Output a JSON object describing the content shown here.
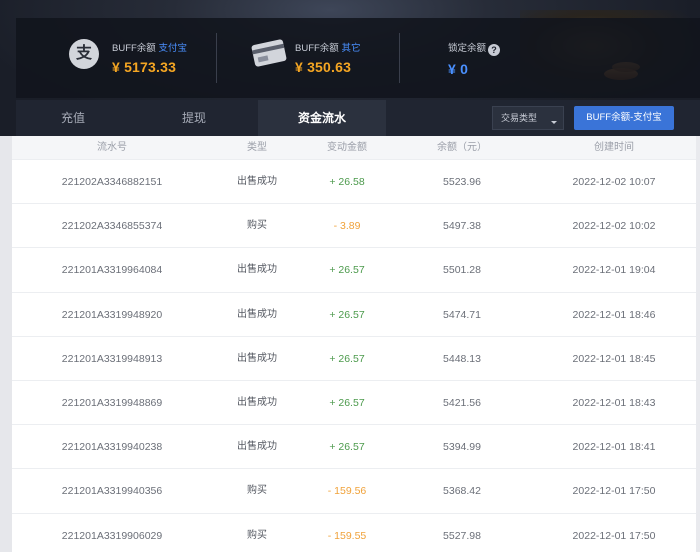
{
  "balances": [
    {
      "label": "BUFF余额",
      "label_link": "支付宝",
      "amount": "¥ 5173.33",
      "icon": "alipay-icon",
      "icon_glyph": "支"
    },
    {
      "label": "BUFF余额",
      "label_link": "其它",
      "amount": "¥ 350.63",
      "icon": "bank-card-icon"
    },
    {
      "label": "锁定余额",
      "help": "?",
      "amount": "¥ 0"
    }
  ],
  "tabs": [
    {
      "label": "充值"
    },
    {
      "label": "提现"
    },
    {
      "label": "资金流水",
      "active": true
    }
  ],
  "filter": {
    "select_label": "交易类型",
    "button_label": "BUFF余额-支付宝"
  },
  "table": {
    "headers": [
      "流水号",
      "类型",
      "变动金额",
      "余额（元）",
      "创建时间"
    ],
    "rows": [
      {
        "id": "221202A3346882151",
        "type": "出售成功",
        "change": "+ 26.58",
        "balance": "5523.96",
        "time": "2022-12-02 10:07",
        "sign": "pos"
      },
      {
        "id": "221202A3346855374",
        "type": "购买",
        "change": "- 3.89",
        "balance": "5497.38",
        "time": "2022-12-02 10:02",
        "sign": "neg"
      },
      {
        "id": "221201A3319964084",
        "type": "出售成功",
        "change": "+ 26.57",
        "balance": "5501.28",
        "time": "2022-12-01 19:04",
        "sign": "pos"
      },
      {
        "id": "221201A3319948920",
        "type": "出售成功",
        "change": "+ 26.57",
        "balance": "5474.71",
        "time": "2022-12-01 18:46",
        "sign": "pos"
      },
      {
        "id": "221201A3319948913",
        "type": "出售成功",
        "change": "+ 26.57",
        "balance": "5448.13",
        "time": "2022-12-01 18:45",
        "sign": "pos"
      },
      {
        "id": "221201A3319948869",
        "type": "出售成功",
        "change": "+ 26.57",
        "balance": "5421.56",
        "time": "2022-12-01 18:43",
        "sign": "pos"
      },
      {
        "id": "221201A3319940238",
        "type": "出售成功",
        "change": "+ 26.57",
        "balance": "5394.99",
        "time": "2022-12-01 18:41",
        "sign": "pos"
      },
      {
        "id": "221201A3319940356",
        "type": "购买",
        "change": "- 159.56",
        "balance": "5368.42",
        "time": "2022-12-01 17:50",
        "sign": "neg"
      },
      {
        "id": "221201A3319906029",
        "type": "购买",
        "change": "- 159.55",
        "balance": "5527.98",
        "time": "2022-12-01 17:50",
        "sign": "neg"
      }
    ]
  },
  "colors": {
    "accent": "#3a74d8",
    "amount": "#f5a623",
    "positive": "#4c9a4c",
    "negative": "#f0a23a",
    "link": "#4a90ff"
  }
}
